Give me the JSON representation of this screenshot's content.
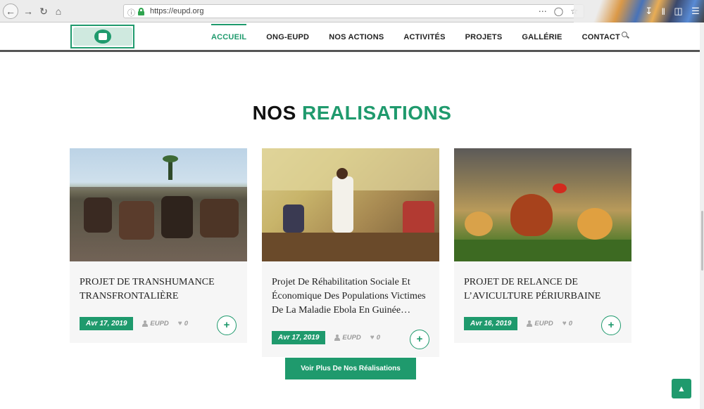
{
  "browser": {
    "url": "https://eupd.org"
  },
  "header": {
    "menu": [
      {
        "label": "ACCUEIL",
        "active": true
      },
      {
        "label": "ONG-EUPD",
        "active": false
      },
      {
        "label": "NOS ACTIONS",
        "active": false
      },
      {
        "label": "ACTIVITÉS",
        "active": false
      },
      {
        "label": "PROJETS",
        "active": false
      },
      {
        "label": "GALLÉRIE",
        "active": false
      },
      {
        "label": "CONTACT",
        "active": false
      }
    ]
  },
  "section": {
    "title_part1": "NOS",
    "title_part2": "REALISATIONS"
  },
  "cards": [
    {
      "title": "PROJET DE TRANSHUMANCE TRANSFRONTALIÈRE",
      "date": "Avr 17, 2019",
      "author": "EUPD",
      "likes": "0",
      "plus": "+"
    },
    {
      "title": "Projet De Réhabilitation Sociale Et Économique Des Populations Victimes De La Maladie Ebola En Guinée…",
      "date": "Avr 17, 2019",
      "author": "EUPD",
      "likes": "0",
      "plus": "+"
    },
    {
      "title": "PROJET DE RELANCE DE L’AVICULTURE PÉRIURBAINE",
      "date": "Avr 16, 2019",
      "author": "EUPD",
      "likes": "0",
      "plus": "+"
    }
  ],
  "cta": {
    "label": "Voir Plus De Nos Réalisations"
  },
  "colors": {
    "accent": "#1f9a6d"
  },
  "icons": [
    "back-icon",
    "forward-icon",
    "reload-icon",
    "home-icon",
    "info-icon",
    "lock-icon",
    "more-icon",
    "pocket-icon",
    "bookmark-icon",
    "download-icon",
    "library-icon",
    "sidebar-icon",
    "menu-icon",
    "search-icon",
    "user-icon",
    "heart-icon",
    "plus-icon",
    "arrow-up-icon"
  ]
}
